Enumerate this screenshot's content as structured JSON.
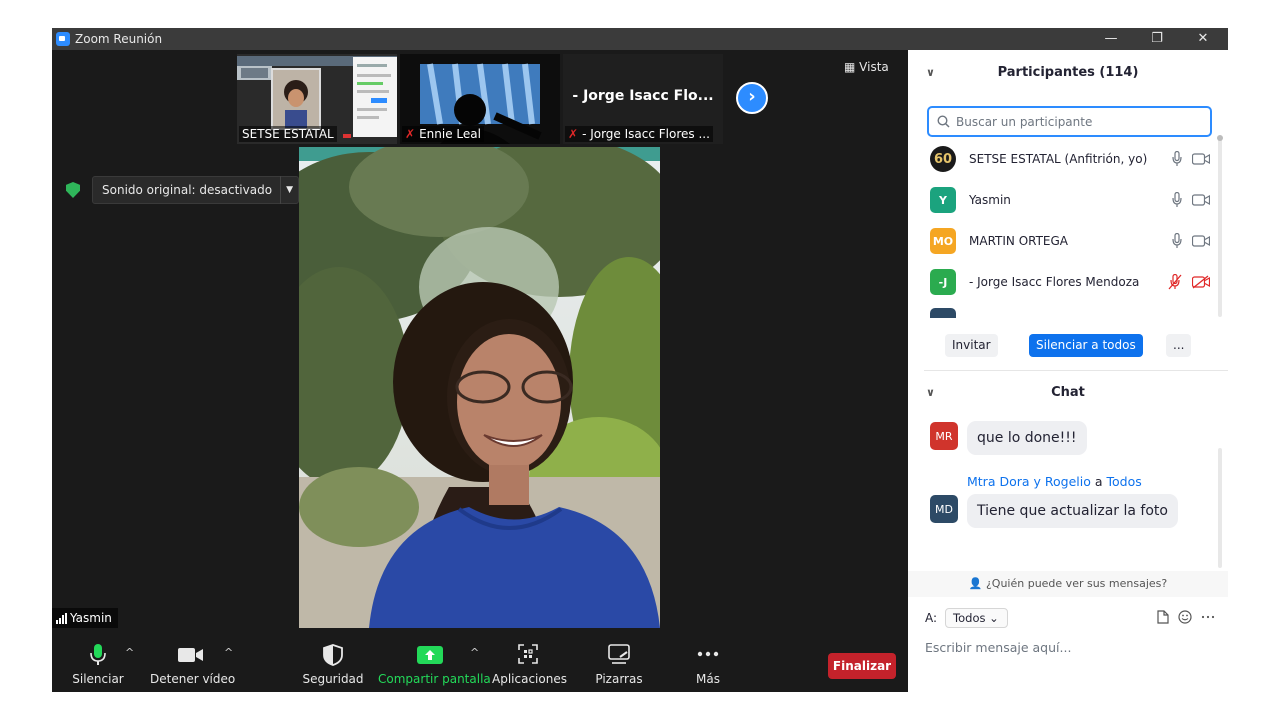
{
  "window": {
    "title": "Zoom Reunión",
    "min_glyph": "—",
    "restore_glyph": "❐",
    "close_glyph": "✕"
  },
  "stage": {
    "thumbnails": [
      {
        "label": "SETSE ESTATAL",
        "muted": false
      },
      {
        "label": "Ennie Leal",
        "muted": true
      },
      {
        "label": "- Jorge Isacc Flores ...",
        "muted": true,
        "big_name": "- Jorge Isacc Flo..."
      }
    ],
    "view_label": "Vista",
    "audio_setting": "Sonido original: desactivado",
    "speaker_label": "Yasmin"
  },
  "toolbar": {
    "mute_label": "Silenciar",
    "video_label": "Detener vídeo",
    "security_label": "Seguridad",
    "share_label": "Compartir pantalla",
    "apps_label": "Aplicaciones",
    "whiteboards_label": "Pizarras",
    "more_label": "Más",
    "end_label": "Finalizar",
    "share_color": "#23d959"
  },
  "participants": {
    "header": "Participantes (114)",
    "search_placeholder": "Buscar un participante",
    "list": [
      {
        "initials": "60",
        "name": "SETSE ESTATAL (Anfitrión, yo)",
        "color": "#1a1a1a",
        "muted": false
      },
      {
        "initials": "Y",
        "name": "Yasmin",
        "color": "#1ba37e",
        "muted": false
      },
      {
        "initials": "MO",
        "name": "MARTIN ORTEGA",
        "color": "#f5a623",
        "muted": false
      },
      {
        "initials": "-J",
        "name": "- Jorge Isacc Flores Mendoza",
        "color": "#2bab4f",
        "muted": true
      }
    ],
    "invite_label": "Invitar",
    "mute_all_label": "Silenciar a todos",
    "more_label": "..."
  },
  "chat": {
    "header": "Chat",
    "messages": [
      {
        "initials": "MR",
        "color": "#d0342c",
        "text": "que lo done!!!"
      },
      {
        "initials": "MD",
        "color": "#2d4a66",
        "sender": "Mtra Dora y Rogelio",
        "to_word": "a",
        "recipient": "Todos",
        "text": "Tiene que actualizar la foto"
      }
    ],
    "privacy_text": "¿Quién puede ver sus mensajes?",
    "to_label": "A:",
    "to_value": "Todos",
    "input_placeholder": "Escribir mensaje aquí..."
  }
}
